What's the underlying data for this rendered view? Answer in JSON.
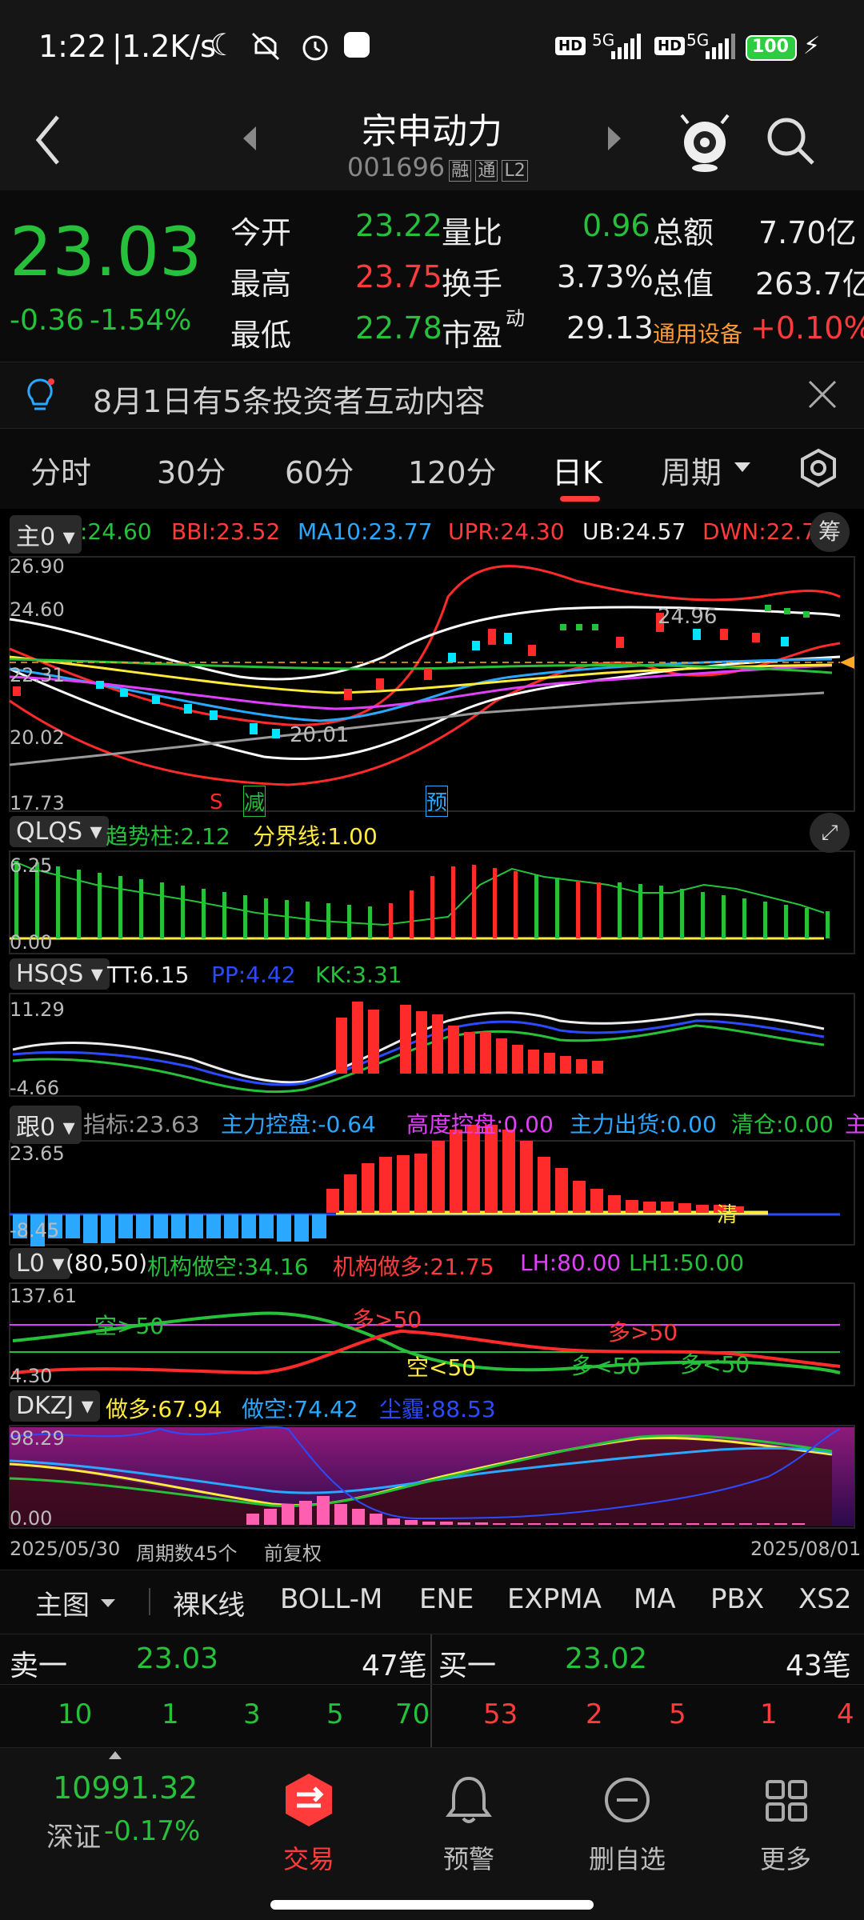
{
  "status_bar": {
    "time": "1:22",
    "speed": "1.2K/s",
    "battery": "100",
    "net1": "5G",
    "net2": "5G",
    "hd": "HD"
  },
  "header": {
    "stock_name": "宗申动力",
    "stock_code": "001696",
    "tags": [
      "融",
      "通",
      "L2"
    ]
  },
  "quote": {
    "price": "23.03",
    "change": "-0.36",
    "change_pct": "-1.54%",
    "open_label": "今开",
    "open": "23.22",
    "high_label": "最高",
    "high": "23.75",
    "low_label": "最低",
    "low": "22.78",
    "vol_ratio_label": "量比",
    "vol_ratio": "0.96",
    "turnover_label": "换手",
    "turnover": "3.73%",
    "pe_label": "市盈",
    "pe_sup": "动",
    "pe": "29.13",
    "amount_label": "总额",
    "amount": "7.70亿",
    "mktcap_label": "总值",
    "mktcap": "263.7亿",
    "sector": "通用设备",
    "sector_pct": "+0.10%"
  },
  "notice": {
    "text": "8月1日有5条投资者互动内容"
  },
  "period_tabs": [
    "分时",
    "30分",
    "60分",
    "120分",
    "日K",
    "周期"
  ],
  "main_panel": {
    "selector": "主0",
    "legend": [
      {
        "text": ":24.60",
        "color": "#26c03a"
      },
      {
        "text": "BBI:23.52",
        "color": "#ff3b3b"
      },
      {
        "text": "MA10:23.77",
        "color": "#2aa8ff"
      },
      {
        "text": "UPR:24.30",
        "color": "#ff3b3b"
      },
      {
        "text": "UB:24.57",
        "color": "#ececec"
      },
      {
        "text": "DWN:22.7",
        "color": "#ff3b3b"
      }
    ],
    "chip_button": "筹",
    "y_labels": [
      "26.90",
      "24.60",
      "22.31",
      "20.02",
      "17.73"
    ],
    "annotations": {
      "high": "24.96",
      "low": "20.01",
      "s": "S",
      "reduce": "减",
      "pre": "预"
    }
  },
  "qlqs": {
    "selector": "QLQS",
    "legend": [
      {
        "text": "趋势柱:2.12",
        "color": "#26c03a"
      },
      {
        "text": "分界线:1.00",
        "color": "#ffeb3b"
      }
    ],
    "y_labels": [
      "6.25",
      "0.00"
    ]
  },
  "hsqs": {
    "selector": "HSQS",
    "legend": [
      {
        "text": "TT:6.15",
        "color": "#ececec"
      },
      {
        "text": "PP:4.42",
        "color": "#2a4bff"
      },
      {
        "text": "KK:3.31",
        "color": "#26c03a"
      }
    ],
    "y_labels": [
      "11.29",
      "-4.66"
    ]
  },
  "gen": {
    "selector": "跟0",
    "legend": [
      {
        "text": "指标:23.63",
        "color": "#9a9a9a"
      },
      {
        "text": "主力控盘:-0.64",
        "color": "#2aa8ff"
      },
      {
        "text": "高度控盘:0.00",
        "color": "#e040fb"
      },
      {
        "text": "主力出货:0.00",
        "color": "#2aa8ff"
      },
      {
        "text": "清仓:0.00",
        "color": "#26c03a"
      },
      {
        "text": "主",
        "color": "#e040fb"
      }
    ],
    "y_labels": [
      "23.65",
      "-8.45"
    ],
    "annotations": {
      "clear": "清"
    }
  },
  "l0": {
    "selector": "L0",
    "legend": [
      {
        "text": "(80,50)",
        "color": "#ececec"
      },
      {
        "text": "机构做空:34.16",
        "color": "#26c03a"
      },
      {
        "text": "机构做多:21.75",
        "color": "#ff3b3b"
      },
      {
        "text": "LH:80.00",
        "color": "#e040fb"
      },
      {
        "text": "LH1:50.00",
        "color": "#26c03a"
      }
    ],
    "y_labels": [
      "137.61",
      "4.30"
    ],
    "annotations": [
      "空>50",
      "多>50",
      "空<50",
      "多>50",
      "多<50",
      "多<50"
    ]
  },
  "dkzj": {
    "selector": "DKZJ",
    "legend": [
      {
        "text": "做多:67.94",
        "color": "#ffeb3b"
      },
      {
        "text": "做空:74.42",
        "color": "#2aa8ff"
      },
      {
        "text": "尘霾:88.53",
        "color": "#2a4bff"
      }
    ],
    "y_labels": [
      "98.29",
      "0.00"
    ]
  },
  "footer_dates": {
    "start": "2025/05/30",
    "count": "周期数45个",
    "adjust": "前复权",
    "end": "2025/08/01"
  },
  "indicator_tabs": [
    "主图",
    "裸K线",
    "BOLL-M",
    "ENE",
    "EXPMA",
    "MA",
    "PBX",
    "XS2"
  ],
  "orderbook": {
    "sell_label": "卖一",
    "sell_price": "23.03",
    "sell_count": "47笔",
    "buy_label": "买一",
    "buy_price": "23.02",
    "buy_count": "43笔",
    "sell_sizes": [
      "10",
      "1",
      "3",
      "5",
      "70"
    ],
    "buy_sizes": [
      "53",
      "2",
      "5",
      "1",
      "4"
    ]
  },
  "bottom_nav": {
    "index_value": "10991.32",
    "index_name": "深证",
    "index_pct": "-0.17%",
    "items": [
      "交易",
      "预警",
      "删自选",
      "更多"
    ]
  }
}
